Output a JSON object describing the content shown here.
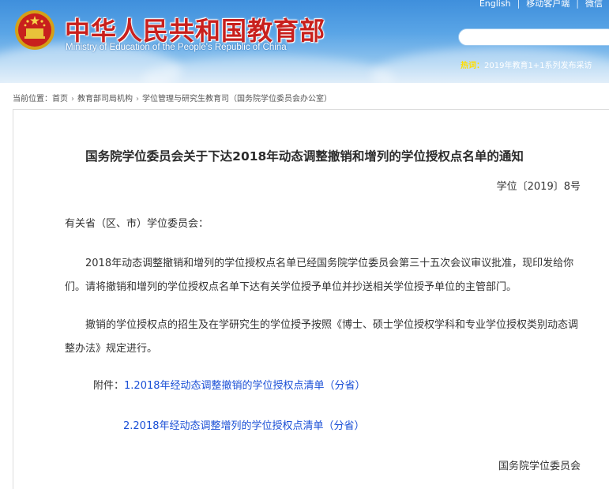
{
  "header": {
    "title_cn": "中华人民共和国教育部",
    "title_en": "Ministry of Education of the People's Republic of China",
    "top_links": [
      "English",
      "移动客户端",
      "微信"
    ],
    "search_placeholder": "",
    "hot_label": "热词：",
    "hot_text": "2019年教育1+1系列发布采访"
  },
  "breadcrumb": {
    "prefix": "当前位置：",
    "items": [
      "首页",
      "教育部司局机构",
      "学位管理与研究生教育司（国务院学位委员会办公室）"
    ]
  },
  "document": {
    "title": "国务院学位委员会关于下达2018年动态调整撤销和增列的学位授权点名单的通知",
    "number": "学位〔2019〕8号",
    "salutation": "有关省（区、市）学位委员会：",
    "paragraphs": [
      "2018年动态调整撤销和增列的学位授权点名单已经国务院学位委员会第三十五次会议审议批准，现印发给你们。请将撤销和增列的学位授权点名单下达有关学位授予单位并抄送相关学位授予单位的主管部门。",
      "撤销的学位授权点的招生及在学研究生的学位授予按照《博士、硕士学位授权学科和专业学位授权类别动态调整办法》规定进行。"
    ],
    "attachments_label": "附件：",
    "attachments": [
      "1.2018年经动态调整撤销的学位授权点清单（分省）",
      "2.2018年经动态调整增列的学位授权点清单（分省）"
    ],
    "signature": "国务院学位委员会"
  },
  "colors": {
    "title_red": "#c8201d",
    "link_blue": "#1a4fd6",
    "header_blue": "#3f8fdc"
  }
}
